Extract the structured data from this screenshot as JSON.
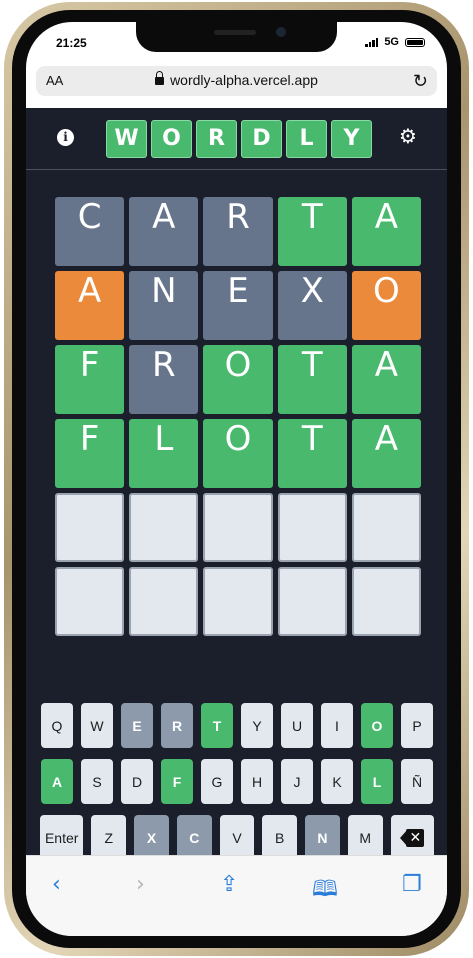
{
  "status_bar": {
    "time": "21:25",
    "network": "5G"
  },
  "browser": {
    "text_size_label": "AA",
    "url": "wordly-alpha.vercel.app"
  },
  "app": {
    "logo_letters": [
      "W",
      "O",
      "R",
      "D",
      "L",
      "Y"
    ],
    "colors": {
      "correct": "#49b96e",
      "present": "#ea8a3a",
      "absent": "#66758b",
      "background": "#1b1f2c"
    },
    "grid": [
      [
        {
          "letter": "C",
          "state": "absent"
        },
        {
          "letter": "A",
          "state": "absent"
        },
        {
          "letter": "R",
          "state": "absent"
        },
        {
          "letter": "T",
          "state": "correct"
        },
        {
          "letter": "A",
          "state": "correct"
        }
      ],
      [
        {
          "letter": "A",
          "state": "present"
        },
        {
          "letter": "N",
          "state": "absent"
        },
        {
          "letter": "E",
          "state": "absent"
        },
        {
          "letter": "X",
          "state": "absent"
        },
        {
          "letter": "O",
          "state": "present"
        }
      ],
      [
        {
          "letter": "F",
          "state": "correct"
        },
        {
          "letter": "R",
          "state": "absent"
        },
        {
          "letter": "O",
          "state": "correct"
        },
        {
          "letter": "T",
          "state": "correct"
        },
        {
          "letter": "A",
          "state": "correct"
        }
      ],
      [
        {
          "letter": "F",
          "state": "correct"
        },
        {
          "letter": "L",
          "state": "correct"
        },
        {
          "letter": "O",
          "state": "correct"
        },
        {
          "letter": "T",
          "state": "correct"
        },
        {
          "letter": "A",
          "state": "correct"
        }
      ],
      [
        {
          "letter": "",
          "state": "empty"
        },
        {
          "letter": "",
          "state": "empty"
        },
        {
          "letter": "",
          "state": "empty"
        },
        {
          "letter": "",
          "state": "empty"
        },
        {
          "letter": "",
          "state": "empty"
        }
      ],
      [
        {
          "letter": "",
          "state": "empty"
        },
        {
          "letter": "",
          "state": "empty"
        },
        {
          "letter": "",
          "state": "empty"
        },
        {
          "letter": "",
          "state": "empty"
        },
        {
          "letter": "",
          "state": "empty"
        }
      ]
    ],
    "keyboard": {
      "row1": [
        {
          "key": "Q",
          "state": ""
        },
        {
          "key": "W",
          "state": ""
        },
        {
          "key": "E",
          "state": "absent"
        },
        {
          "key": "R",
          "state": "absent"
        },
        {
          "key": "T",
          "state": "correct"
        },
        {
          "key": "Y",
          "state": ""
        },
        {
          "key": "U",
          "state": ""
        },
        {
          "key": "I",
          "state": ""
        },
        {
          "key": "O",
          "state": "correct"
        },
        {
          "key": "P",
          "state": ""
        }
      ],
      "row2": [
        {
          "key": "A",
          "state": "correct"
        },
        {
          "key": "S",
          "state": ""
        },
        {
          "key": "D",
          "state": ""
        },
        {
          "key": "F",
          "state": "correct"
        },
        {
          "key": "G",
          "state": ""
        },
        {
          "key": "H",
          "state": ""
        },
        {
          "key": "J",
          "state": ""
        },
        {
          "key": "K",
          "state": ""
        },
        {
          "key": "L",
          "state": "correct"
        },
        {
          "key": "Ñ",
          "state": ""
        }
      ],
      "row3": [
        {
          "key": "Z",
          "state": ""
        },
        {
          "key": "X",
          "state": "absent"
        },
        {
          "key": "C",
          "state": "absent"
        },
        {
          "key": "V",
          "state": ""
        },
        {
          "key": "B",
          "state": ""
        },
        {
          "key": "N",
          "state": "absent"
        },
        {
          "key": "M",
          "state": ""
        }
      ],
      "enter_label": "Enter"
    }
  }
}
